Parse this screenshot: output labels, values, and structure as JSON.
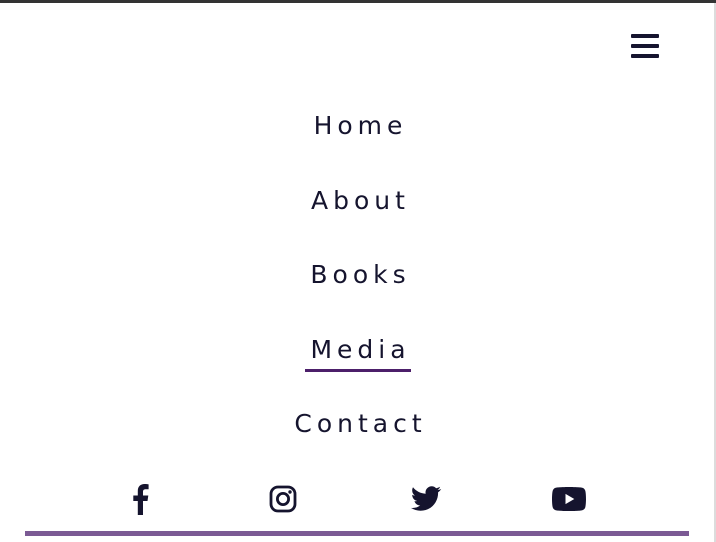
{
  "header": {
    "menu_icon": "hamburger-menu-icon"
  },
  "nav": {
    "items": [
      {
        "label": "Home",
        "active": false
      },
      {
        "label": "About",
        "active": false
      },
      {
        "label": "Books",
        "active": false
      },
      {
        "label": "Media",
        "active": true
      },
      {
        "label": "Contact",
        "active": false
      }
    ]
  },
  "social": {
    "icons": [
      "facebook-icon",
      "instagram-icon",
      "twitter-icon",
      "youtube-icon"
    ]
  },
  "colors": {
    "text": "#15142e",
    "accent": "#4c1f6a",
    "footer_bar": "#7b5a94",
    "top_rule": "#333333"
  }
}
